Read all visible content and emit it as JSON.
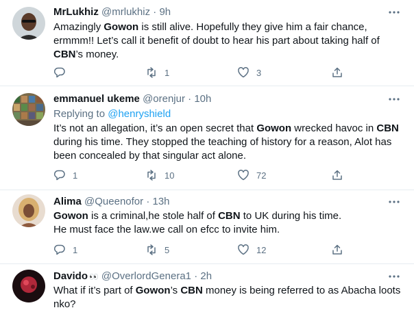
{
  "tweets": [
    {
      "name": "MrLukhiz",
      "handle": "@mrlukhiz",
      "time": "9h",
      "reply_prefix": "",
      "reply_to": "",
      "body": [
        {
          "t": "Amazingly ",
          "b": false
        },
        {
          "t": "Gowon",
          "b": true
        },
        {
          "t": " is still alive. Hopefully they give him a fair chance, ",
          "b": false
        },
        {
          "br": true
        },
        {
          "t": "ermmm!! Let’s call it benefit of doubt to hear his part about taking half of ",
          "b": false
        },
        {
          "br": true
        },
        {
          "t": "CBN",
          "b": true
        },
        {
          "t": "’s money.",
          "b": false
        }
      ],
      "replies": "",
      "retweets": "1",
      "likes": "3",
      "emoji": ""
    },
    {
      "name": "emmanuel ukeme",
      "handle": "@orenjur",
      "time": "10h",
      "reply_prefix": "Replying to ",
      "reply_to": "@henryshield",
      "body": [
        {
          "t": "It’s not an allegation, it’s an open secret that ",
          "b": false
        },
        {
          "t": "Gowon",
          "b": true
        },
        {
          "t": " wrecked havoc in ",
          "b": false
        },
        {
          "t": "CBN",
          "b": true
        },
        {
          "br": true
        },
        {
          "t": "during his time. They stopped the teaching of history for a reason, Alot has",
          "b": false
        },
        {
          "br": true
        },
        {
          "t": "been concealed by that singular act alone.",
          "b": false
        }
      ],
      "replies": "1",
      "retweets": "10",
      "likes": "72",
      "emoji": ""
    },
    {
      "name": "Alima",
      "handle": "@Queenofor",
      "time": "13h",
      "reply_prefix": "",
      "reply_to": "",
      "body": [
        {
          "t": "Gowon",
          "b": true
        },
        {
          "t": " is a criminal,he stole half of ",
          "b": false
        },
        {
          "t": "CBN",
          "b": true
        },
        {
          "t": " to UK during his time.",
          "b": false
        },
        {
          "br": true
        },
        {
          "t": "He must face the law.we call on efcc to invite him.",
          "b": false
        }
      ],
      "replies": "1",
      "retweets": "5",
      "likes": "12",
      "emoji": ""
    },
    {
      "name": "Davido",
      "handle": "@OverlordGenera1",
      "time": "2h",
      "reply_prefix": "",
      "reply_to": "",
      "body": [
        {
          "t": "What if it’s part of ",
          "b": false
        },
        {
          "t": "Gowon",
          "b": true
        },
        {
          "t": "’s ",
          "b": false
        },
        {
          "t": "CBN",
          "b": true
        },
        {
          "t": " money is being referred to as Abacha loots",
          "b": false
        },
        {
          "br": true
        },
        {
          "t": "nko?",
          "b": false
        }
      ],
      "replies": "",
      "retweets": "",
      "likes": "",
      "emoji": "👀"
    }
  ],
  "icons": {
    "reply": "reply-icon",
    "retweet": "retweet-icon",
    "like": "heart-icon",
    "share": "share-icon",
    "more": "more-icon"
  },
  "colors": {
    "text": "#0f1419",
    "secondary": "#5b7083",
    "link": "#1da1f2",
    "divider": "#e6ecf0"
  }
}
